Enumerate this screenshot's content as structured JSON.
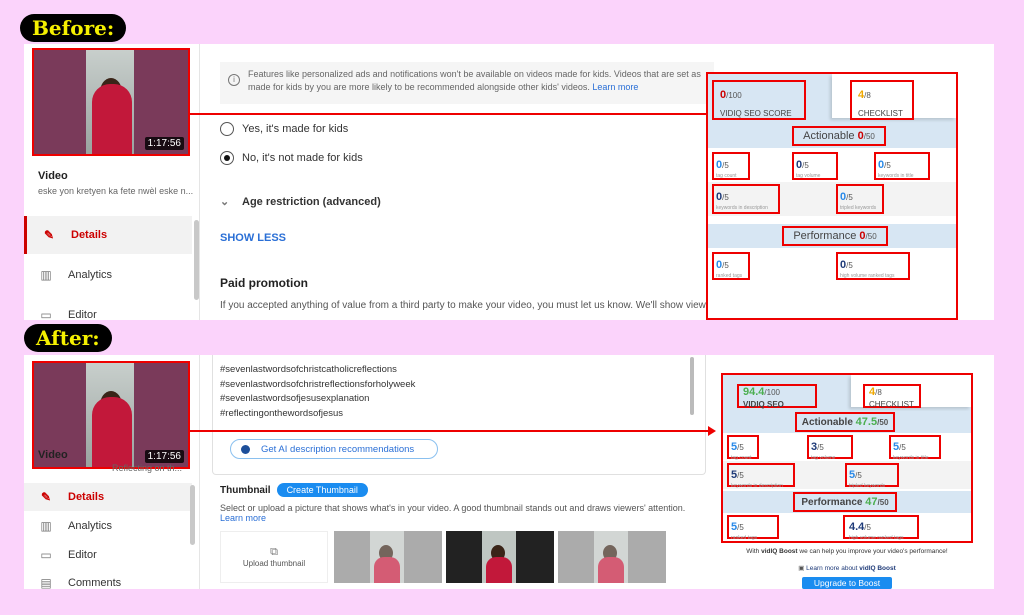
{
  "before": {
    "tag": "Before:",
    "video": {
      "duration": "1:17:56",
      "label": "Video",
      "subtitle": "eske yon kretyen ka fete nwèl eske n..."
    },
    "nav": [
      {
        "label": "Details",
        "icon": "pencil-icon"
      },
      {
        "label": "Analytics",
        "icon": "analytics-icon"
      },
      {
        "label": "Editor",
        "icon": "editor-icon"
      }
    ],
    "info_text": "Features like personalized ads and notifications won't be available on videos made for kids. Videos that are set as made for kids by you are more likely to be recommended alongside other kids' videos.",
    "info_link": "Learn more",
    "radio_yes": "Yes, it's made for kids",
    "radio_no": "No, it's not made for kids",
    "age_restriction": "Age restriction (advanced)",
    "show_less": "SHOW LESS",
    "paid_title": "Paid promotion",
    "paid_text": "If you accepted anything of value from a third party to make your video, you must let us know. We'll show viewers a",
    "seo": {
      "score": "0",
      "score_max": "/100",
      "score_label": "VIDIQ SEO SCORE",
      "checklist": "4",
      "checklist_max": "/8",
      "checklist_label": "CHECKLIST",
      "actionable_label": "Actionable",
      "actionable": "0",
      "actionable_max": "/50",
      "tag_count": "0",
      "tag_volume": "0",
      "kw_title": "0",
      "kw_desc": "0",
      "tripled": "0",
      "performance_label": "Performance",
      "performance": "0",
      "performance_max": "/50",
      "ranked": "0",
      "hv_ranked": "0",
      "max5": "/5",
      "lbl_tag_count": "tag count",
      "lbl_tag_volume": "tag volume",
      "lbl_kw_title": "keywords in title",
      "lbl_kw_desc": "keywords in description",
      "lbl_tripled": "tripled keywords",
      "lbl_ranked": "ranked tags",
      "lbl_hv_ranked": "high volume ranked tags"
    }
  },
  "after": {
    "tag": "After:",
    "video": {
      "duration": "1:17:56",
      "label": "Video",
      "subtitle": "Reflecting on th..."
    },
    "nav": [
      {
        "label": "Details",
        "icon": "pencil-icon"
      },
      {
        "label": "Analytics",
        "icon": "analytics-icon"
      },
      {
        "label": "Editor",
        "icon": "editor-icon"
      },
      {
        "label": "Comments",
        "icon": "comments-icon"
      }
    ],
    "hashtags": [
      "#sevenlastwordsofchristcatholicreflections",
      "#sevenlastwordsofchristreflectionsforholyweek",
      "#sevenlastwordsofjesusexplanation",
      "#reflectingonthewordsofjesus"
    ],
    "ai_button": "Get AI description recommendations",
    "thumbnail_title": "Thumbnail",
    "create_thumbnail": "Create Thumbnail",
    "thumbnail_text": "Select or upload a picture that shows what's in your video. A good thumbnail stands out and draws viewers' attention.",
    "learn_more": "Learn more",
    "upload_thumbnail": "Upload thumbnail",
    "seo": {
      "score": "94.4",
      "score_max": "/100",
      "score_label": "VIDIQ SEO SCORE",
      "checklist": "4",
      "checklist_max": "/8",
      "checklist_label": "CHECKLIST",
      "actionable_label": "Actionable",
      "actionable": "47.5",
      "actionable_max": "/50",
      "tag_count": "5",
      "tag_volume": "3",
      "kw_title": "5",
      "kw_desc": "5",
      "tripled": "5",
      "performance_label": "Performance",
      "performance": "47",
      "performance_max": "/50",
      "ranked": "5",
      "hv_ranked": "4.4",
      "max5": "/5",
      "lbl_tag_count": "tag count",
      "lbl_tag_volume": "tag volume",
      "lbl_kw_title": "keywords in title",
      "lbl_kw_desc": "keywords in description",
      "lbl_tripled": "tripled keywords",
      "lbl_ranked": "ranked tags",
      "lbl_hv_ranked": "high volume ranked tags"
    },
    "boost_text_pre": "With ",
    "boost_brand": "vidIQ Boost",
    "boost_text_post": " we can help you improve your video's performance!",
    "boost_learn": "Learn more about ",
    "upgrade_button": "Upgrade to Boost"
  },
  "colors": {
    "red": "#e00000",
    "green": "#4caf50",
    "blue": "#2a8ae8",
    "navy": "#1e3a78",
    "orange": "#f0a800",
    "pink_bg": "#fbd3fb"
  }
}
